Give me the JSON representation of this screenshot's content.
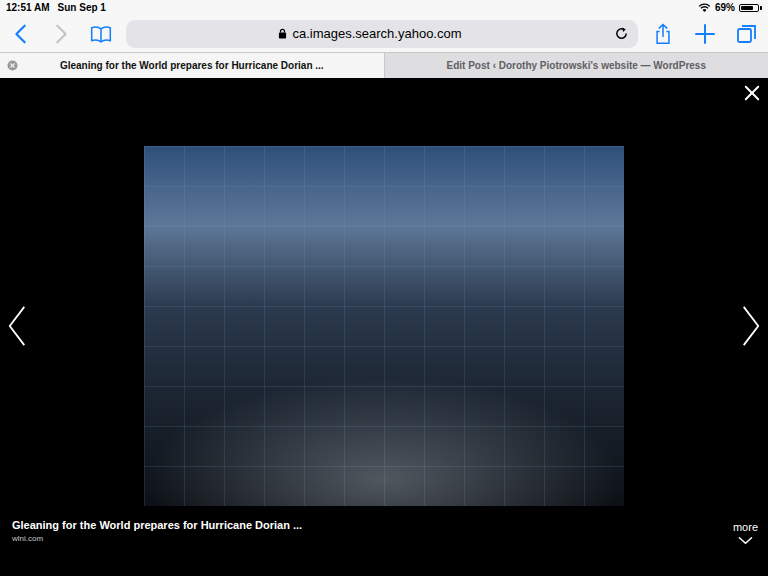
{
  "status_bar": {
    "time": "12:51 AM",
    "date": "Sun Sep 1",
    "battery": "69%",
    "battery_level": 0.69
  },
  "toolbar": {
    "back_enabled": true,
    "forward_enabled": false,
    "address": "ca.images.search.yahoo.com",
    "secure": true
  },
  "tabs": [
    {
      "label": "Gleaning for the World prepares for Hurricane Dorian ...",
      "selected": true
    },
    {
      "label": "Edit Post ‹ Dorothy Piotrowski's website — WordPress",
      "selected": false
    }
  ],
  "lightbox": {
    "caption": "Gleaning for the World prepares for Hurricane Dorian ...",
    "source": "wlni.com",
    "more": "more"
  }
}
